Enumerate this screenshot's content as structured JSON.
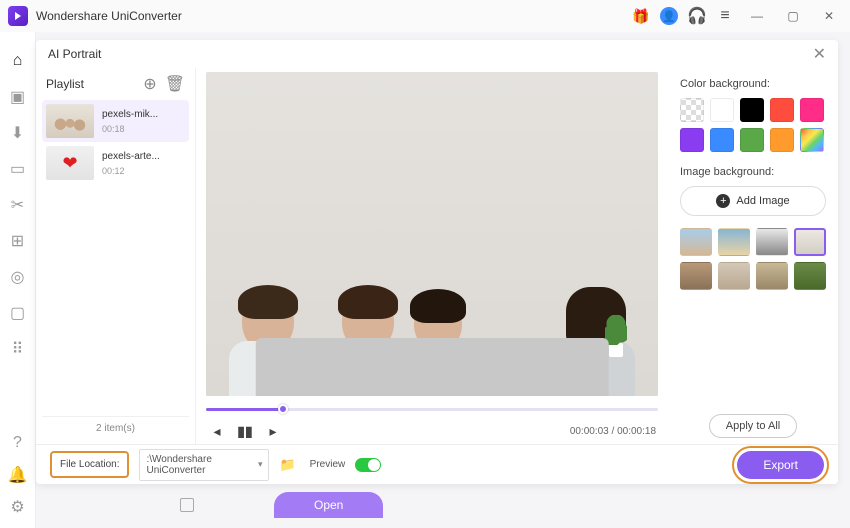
{
  "app": {
    "title": "Wondershare UniConverter"
  },
  "modal": {
    "title": "AI Portrait"
  },
  "playlist": {
    "title": "Playlist",
    "items": [
      {
        "name": "pexels-mik...",
        "duration": "00:18"
      },
      {
        "name": "pexels-arte...",
        "duration": "00:12"
      }
    ],
    "count_label": "2 item(s)"
  },
  "player": {
    "time_current": "00:00:03",
    "time_total": "00:00:18",
    "time_display": "00:00:03 / 00:00:18"
  },
  "right": {
    "color_label": "Color background:",
    "image_label": "Image background:",
    "add_image": "Add Image",
    "apply_all": "Apply to All",
    "colors": [
      "transparent",
      "#ffffff",
      "#000000",
      "#ff4d3d",
      "#ff2d88",
      "#8a3df0",
      "#3a8bff",
      "#5aa848",
      "#ff9a2d",
      "rainbow"
    ]
  },
  "footer": {
    "file_location_label": "File Location:",
    "file_location_value": ":\\Wondershare UniConverter",
    "preview_label": "Preview",
    "export_label": "Export"
  },
  "below": {
    "open_label": "Open"
  }
}
